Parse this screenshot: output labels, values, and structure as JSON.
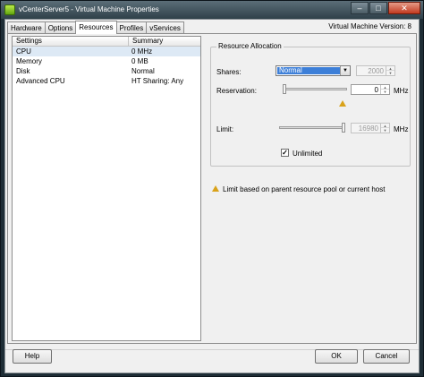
{
  "window": {
    "title": "vCenterServer5 - Virtual Machine Properties",
    "minimize_glyph": "–",
    "maximize_glyph": "□",
    "close_glyph": "✕"
  },
  "tabs": [
    {
      "label": "Hardware",
      "active": false
    },
    {
      "label": "Options",
      "active": false
    },
    {
      "label": "Resources",
      "active": true
    },
    {
      "label": "Profiles",
      "active": false
    },
    {
      "label": "vServices",
      "active": false
    }
  ],
  "vm_version": "Virtual Machine Version: 8",
  "settings_table": {
    "headers": [
      "Settings",
      "Summary"
    ],
    "rows": [
      {
        "setting": "CPU",
        "summary": "0 MHz",
        "selected": true
      },
      {
        "setting": "Memory",
        "summary": "0 MB",
        "selected": false
      },
      {
        "setting": "Disk",
        "summary": "Normal",
        "selected": false
      },
      {
        "setting": "Advanced CPU",
        "summary": "HT Sharing: Any",
        "selected": false
      }
    ]
  },
  "resource_allocation": {
    "group_label": "Resource Allocation",
    "shares": {
      "label": "Shares:",
      "value": "Normal",
      "number": "2000"
    },
    "reservation": {
      "label": "Reservation:",
      "value": "0",
      "unit": "MHz",
      "level": 0
    },
    "limit": {
      "label": "Limit:",
      "value": "16980",
      "unit": "MHz",
      "level": 1
    },
    "unlimited": {
      "label": "Unlimited",
      "checked": true,
      "check_glyph": "✓"
    }
  },
  "note": "Limit based on parent resource pool or current host",
  "icons": {
    "app": "vsphere-app-icon",
    "warning": "warning-icon",
    "dropdown": "chevron-down-icon"
  },
  "colors": {
    "selection": "#3d7fd8",
    "warning": "#d9a21a",
    "row_selected": "#dde9f5"
  },
  "buttons": {
    "help": "Help",
    "ok": "OK",
    "cancel": "Cancel"
  }
}
